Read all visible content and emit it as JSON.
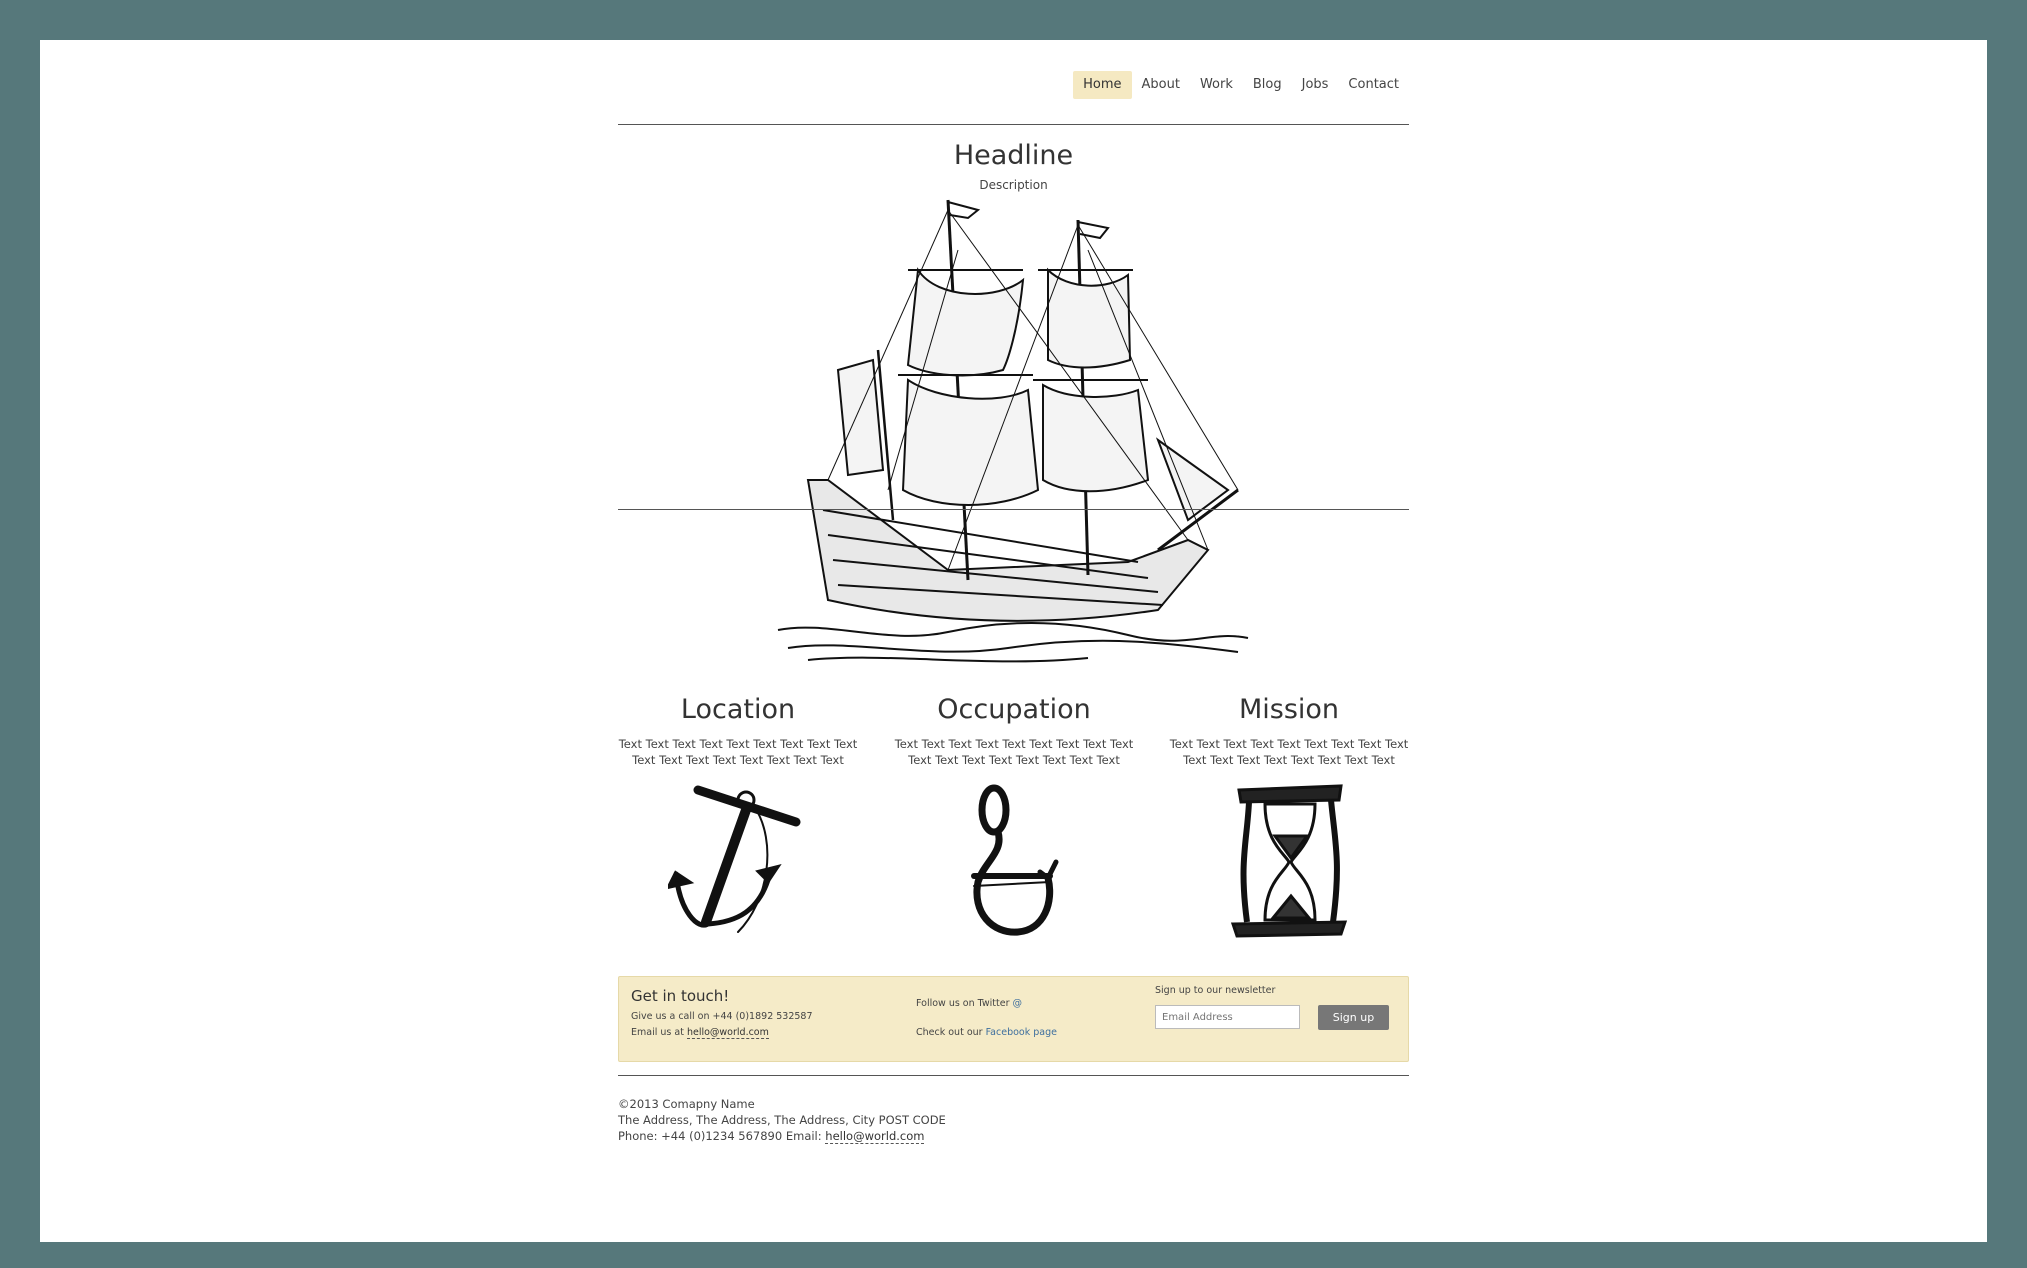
{
  "nav": {
    "items": [
      {
        "label": "Home",
        "active": true
      },
      {
        "label": "About"
      },
      {
        "label": "Work"
      },
      {
        "label": "Blog"
      },
      {
        "label": "Jobs"
      },
      {
        "label": "Contact"
      }
    ]
  },
  "hero": {
    "title": "Headline",
    "description": "Description",
    "image_icon": "sailing-ship-illustration"
  },
  "columns": [
    {
      "title": "Location",
      "text": "Text Text Text Text Text Text Text Text Text Text Text Text Text Text Text Text Text",
      "icon": "anchor-icon"
    },
    {
      "title": "Occupation",
      "text": "Text Text Text Text Text Text Text Text Text Text Text Text Text Text Text Text Text",
      "icon": "hook-icon"
    },
    {
      "title": "Mission",
      "text": "Text Text Text Text Text Text Text Text Text Text Text Text Text Text Text Text Text",
      "icon": "hourglass-icon"
    }
  ],
  "band": {
    "title": "Get in touch!",
    "call_prefix": "Give us a call on",
    "call_number": "+44 (0)1892 532587",
    "email_prefix": "Email us at",
    "email": "hello@world.com",
    "twitter_prefix": "Follow us on Twitter",
    "twitter_link": "@",
    "facebook_prefix": "Check out our",
    "facebook_link": "Facebook page",
    "newsletter_label": "Sign up to our newsletter",
    "email_placeholder": "Email Address",
    "signup_label": "Sign up"
  },
  "footer": {
    "copyright": "©2013 Comapny Name",
    "address": "The Address, The Address, The Address, City POST CODE",
    "phone_text": "Phone: +44 (0)1234 567890 Email:",
    "email": "hello@world.com"
  },
  "colors": {
    "frame": "#56787b",
    "accent": "#f5e9c2",
    "link": "#3e6f9e"
  }
}
